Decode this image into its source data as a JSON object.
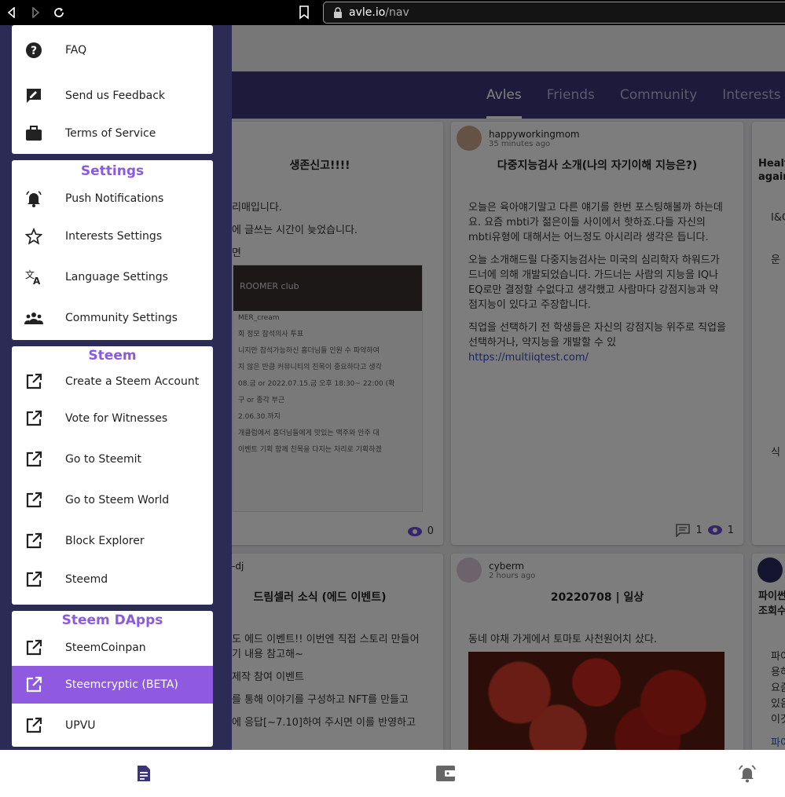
{
  "browser": {
    "url_host": "avle.io",
    "url_path": "/nav"
  },
  "tabs": [
    {
      "label": "Avles",
      "active": true
    },
    {
      "label": "Friends",
      "active": false
    },
    {
      "label": "Community",
      "active": false
    },
    {
      "label": "Interests",
      "active": false
    }
  ],
  "cards": {
    "c1": {
      "title": "생존신고!!!!",
      "body": [
        "리매입니다.",
        "에 글쓰는 시간이 늦었습니다.",
        "면"
      ],
      "shot_head": "ROOMER club",
      "shot_lines": [
        "MER_cream",
        "회 정모 참석의사 투표",
        "니지만 참석가능하신 홈더님들 인원 수 파악하여",
        "지 않은 만큼 커뮤니티의 친목이 중요하다고 생각",
        "08.금 or 2022.07.15.금 오후 18:30~ 22:00 (확",
        "구 or 종각 부근",
        "2.06.30.까지",
        "개클럽에서 홈더님들에게 맛있는 맥주와 안주 대",
        "이벤트 기획 함께 친목을 다지는 자리로 기획하겠"
      ],
      "views": "0"
    },
    "c2": {
      "author": "happyworkingmom",
      "time": "35 minutes ago",
      "title": "다중지능검사 소개(나의 자기이해 지능은?)",
      "body": [
        "오늘은 육아얘기말고 다른 얘기를 한번 포스팅해볼까 하는데요. 요즘 mbti가 젊은이들 사이에서 핫하죠.다들 자신의 mbti유형에 대해서는 어느정도 아시리라 생각은 듭니다.",
        "오늘 소개해드릴 다중지능검사는 미국의 심리학자 하워드가드너에 의해 개발되었습니다. 가드너는 사람의 지능을 IQ나 EQ로만 결정할 수없다고 생각했고 사람마다 강점지능과 약점지능이 있다고 주장합니다.",
        "직업을 선택하기 전 학생들은 자신의 강점지능 위주로 직업을 선택하거나, 약지능을 개발할 수 있"
      ],
      "link": "https://multiiqtest.com/",
      "comments": "1",
      "views": "1"
    },
    "c3": {
      "title": "Healt again",
      "lines": [
        "I&C",
        "운",
        "식"
      ]
    },
    "c4": {
      "author": "-dj",
      "title": "드림셀러 소식 (에드 이벤트)",
      "body": [
        "도 에드 이벤트!! 이번엔 직접 스토리 만들어 기 내용 참고해~",
        "제작 참여 이벤트",
        "를 통해 이야기를 구성하고 NFT를 만들고",
        "에 응답[~7.10]하여 주시면 이를 반영하고"
      ]
    },
    "c5": {
      "author": "cyberm",
      "time": "2 hours ago",
      "title": "20220708 | 일상",
      "body": "동네 야채 가게에서 토마토 사천원어치 샀다."
    },
    "c6": {
      "title": "파이썬 조회수",
      "lines": [
        "파이",
        "용하",
        "요즘",
        "있음",
        "이것",
        "파이"
      ]
    }
  },
  "drawer": {
    "help": [
      {
        "label": "FAQ",
        "icon": "help-circle-icon"
      },
      {
        "label": "Send us Feedback",
        "icon": "feedback-icon"
      },
      {
        "label": "Terms of Service",
        "icon": "briefcase-icon"
      }
    ],
    "settings": {
      "title": "Settings",
      "items": [
        {
          "label": "Push Notifications",
          "icon": "bell-alert-icon"
        },
        {
          "label": "Interests Settings",
          "icon": "star-outline-icon"
        },
        {
          "label": "Language Settings",
          "icon": "translate-icon"
        },
        {
          "label": "Community Settings",
          "icon": "people-icon"
        }
      ]
    },
    "steem": {
      "title": "Steem",
      "items": [
        {
          "label": "Create a Steem Account",
          "icon": "external-link-icon"
        },
        {
          "label": "Vote for Witnesses",
          "icon": "external-link-icon"
        },
        {
          "label": "Go to Steemit",
          "icon": "external-link-icon"
        },
        {
          "label": "Go to Steem World",
          "icon": "external-link-icon"
        },
        {
          "label": "Block Explorer",
          "icon": "external-link-icon"
        },
        {
          "label": "Steemd",
          "icon": "external-link-icon"
        }
      ]
    },
    "dapps": {
      "title": "Steem DApps",
      "items": [
        {
          "label": "SteemCoinpan",
          "icon": "external-link-icon",
          "selected": false
        },
        {
          "label": "Steemcryptic (BETA)",
          "icon": "external-link-icon",
          "selected": true
        },
        {
          "label": "UPVU",
          "icon": "external-link-icon",
          "selected": false
        }
      ]
    }
  },
  "bottom_nav": [
    "posts-icon",
    "wallet-icon",
    "notifications-icon"
  ],
  "colors": {
    "accent": "#8f5ae0",
    "tabbar": "#3a3478"
  }
}
